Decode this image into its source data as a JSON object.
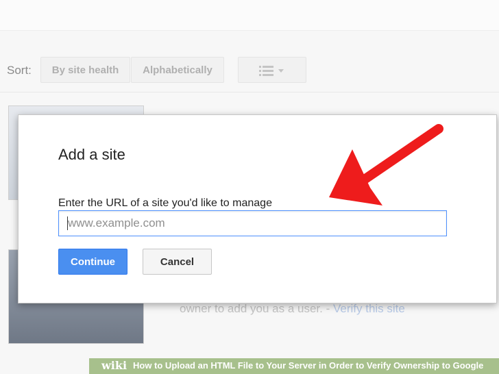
{
  "sort": {
    "label": "Sort:",
    "options": [
      "By site health",
      "Alphabetically"
    ]
  },
  "background": {
    "owner_text": "owner to add you as a user. -",
    "verify_link": "Verify this site"
  },
  "dialog": {
    "title": "Add a site",
    "url_label": "Enter the URL of a site you'd like to manage",
    "url_placeholder": "www.example.com",
    "url_value": "",
    "continue_label": "Continue",
    "cancel_label": "Cancel"
  },
  "annotation": {
    "arrow_color": "#ee1c1c"
  },
  "footer": {
    "brand": "wiki",
    "title": "How to Upload an HTML File to Your Server in Order to Verify Ownership to Google"
  },
  "colors": {
    "primary_button": "#4a8ff0",
    "input_focus_border": "#4d90fe",
    "footer_bar": "#a7c08c"
  }
}
